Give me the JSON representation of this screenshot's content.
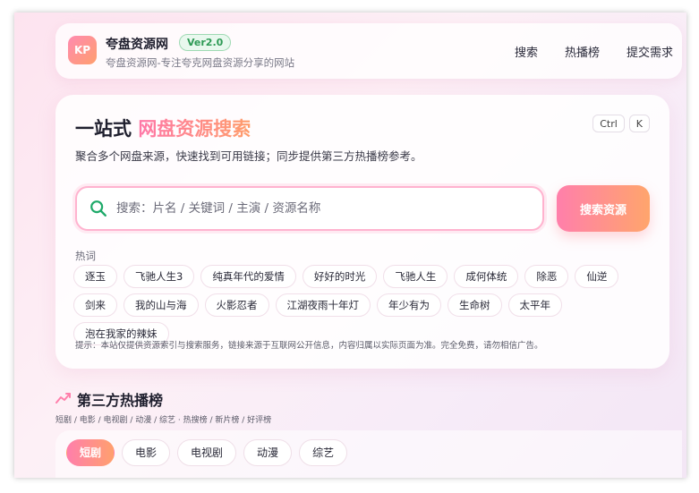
{
  "header": {
    "logo_text": "KP",
    "title": "夸盘资源网",
    "version": "Ver2.0",
    "subtitle": "夸盘资源网-专注夸克网盘资源分享的网站",
    "nav": [
      "搜索",
      "热播榜",
      "提交需求"
    ]
  },
  "hero": {
    "title_plain": "一站式 ",
    "title_accent": "网盘资源搜索",
    "shortcut_keys": [
      "Ctrl",
      "K"
    ],
    "description": "聚合多个网盘来源，快速找到可用链接；同步提供第三方热播榜参考。"
  },
  "search": {
    "placeholder": "搜索：片名 / 关键词 / 主演 / 资源名称",
    "value": "",
    "button_label": "搜索资源"
  },
  "hot": {
    "label": "热词",
    "tags": [
      "逐玉",
      "飞驰人生3",
      "纯真年代的爱情",
      "好好的时光",
      "飞驰人生",
      "成何体统",
      "除恶",
      "仙逆",
      "剑来",
      "我的山与海",
      "火影忍者",
      "江湖夜雨十年灯",
      "年少有为",
      "生命树",
      "太平年",
      "泡在我家的辣妹"
    ]
  },
  "notice": "提示：本站仅提供资源索引与搜索服务，链接来源于互联网公开信息，内容归属以实际页面为准。完全免费，请勿相信广告。",
  "ranking": {
    "title": "第三方热播榜",
    "subtitle": "短剧 / 电影 / 电视剧 / 动漫 / 综艺 · 热搜榜 / 新片榜 / 好评榜",
    "categories": [
      "短剧",
      "电影",
      "电视剧",
      "动漫",
      "综艺"
    ],
    "active_category": "短剧"
  },
  "icons": {
    "search": "search-icon",
    "ranking": "trend-icon"
  },
  "colors": {
    "accent_start": "#ff7fab",
    "accent_end": "#ffa56c",
    "version_green": "#2e9a55",
    "search_icon_green": "#1faa6a"
  }
}
